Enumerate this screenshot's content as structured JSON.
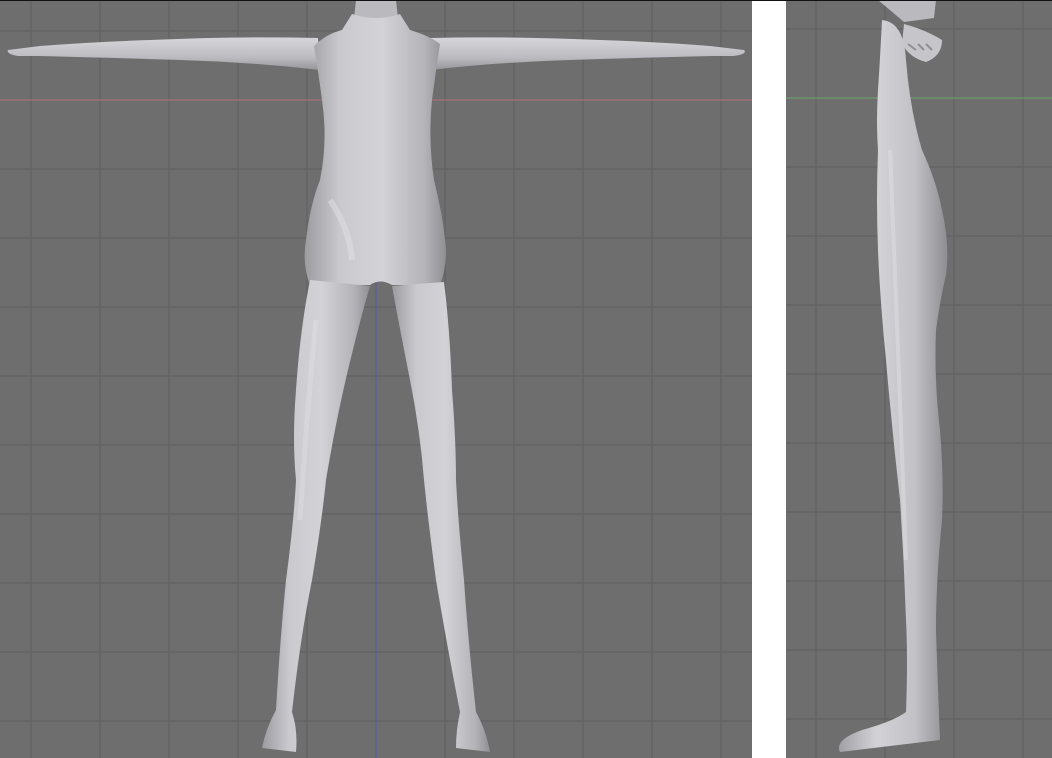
{
  "viewports": {
    "front": {
      "view": "front-orthographic",
      "background_color": "#6e6e6e",
      "grid_color": "#5e5e5e",
      "x_axis_color": "#b76c7e",
      "z_axis_color": "#5a5aa5",
      "model_color": "#c3c3c7"
    },
    "side": {
      "view": "side-orthographic",
      "background_color": "#6e6e6e",
      "grid_color": "#5e5e5e",
      "y_axis_color": "#6ea56e",
      "model_color": "#c3c3c7"
    }
  },
  "separator_color": "#ffffff",
  "icons": [
    "grid-icon"
  ]
}
